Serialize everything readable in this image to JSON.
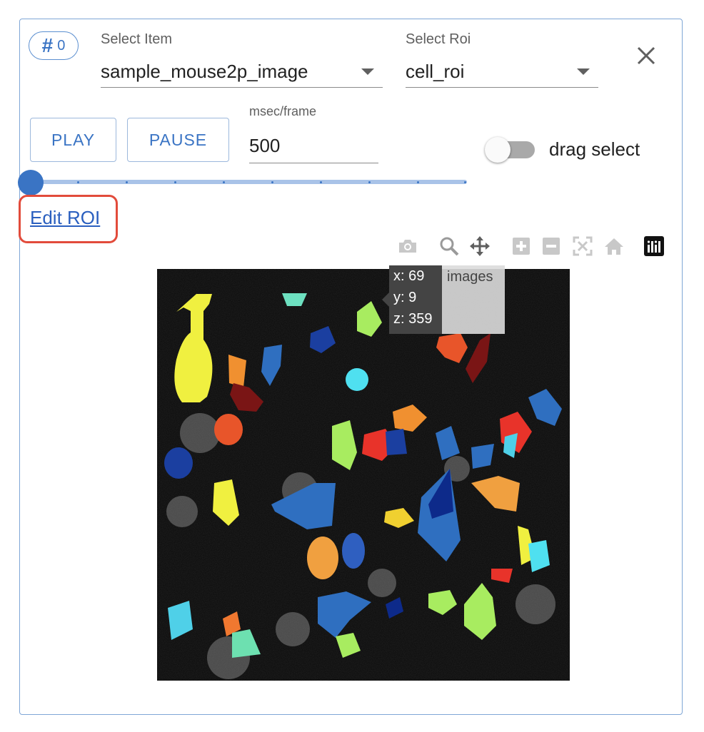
{
  "badge": {
    "symbol": "#",
    "number": "0"
  },
  "select_item": {
    "label": "Select Item",
    "value": "sample_mouse2p_image"
  },
  "select_roi": {
    "label": "Select Roi",
    "value": "cell_roi"
  },
  "controls": {
    "play_label": "PLAY",
    "pause_label": "PAUSE",
    "msec_label": "msec/frame",
    "msec_value": "500",
    "drag_select_label": "drag select",
    "drag_select_on": false,
    "slider_value": 0
  },
  "edit_roi_label": "Edit ROI",
  "toolbar": {
    "icons": [
      "camera-icon",
      "zoom-icon",
      "pan-icon",
      "zoom-in-icon",
      "zoom-out-icon",
      "autoscale-icon",
      "reset-axes-icon",
      "plotly-logo-icon"
    ]
  },
  "plot": {
    "hover": {
      "x": "x: 69",
      "y": "y: 9",
      "z": "z: 359",
      "trace": "images"
    }
  },
  "colors": {
    "accent": "#3a74c4",
    "highlight": "#e24b3b"
  }
}
